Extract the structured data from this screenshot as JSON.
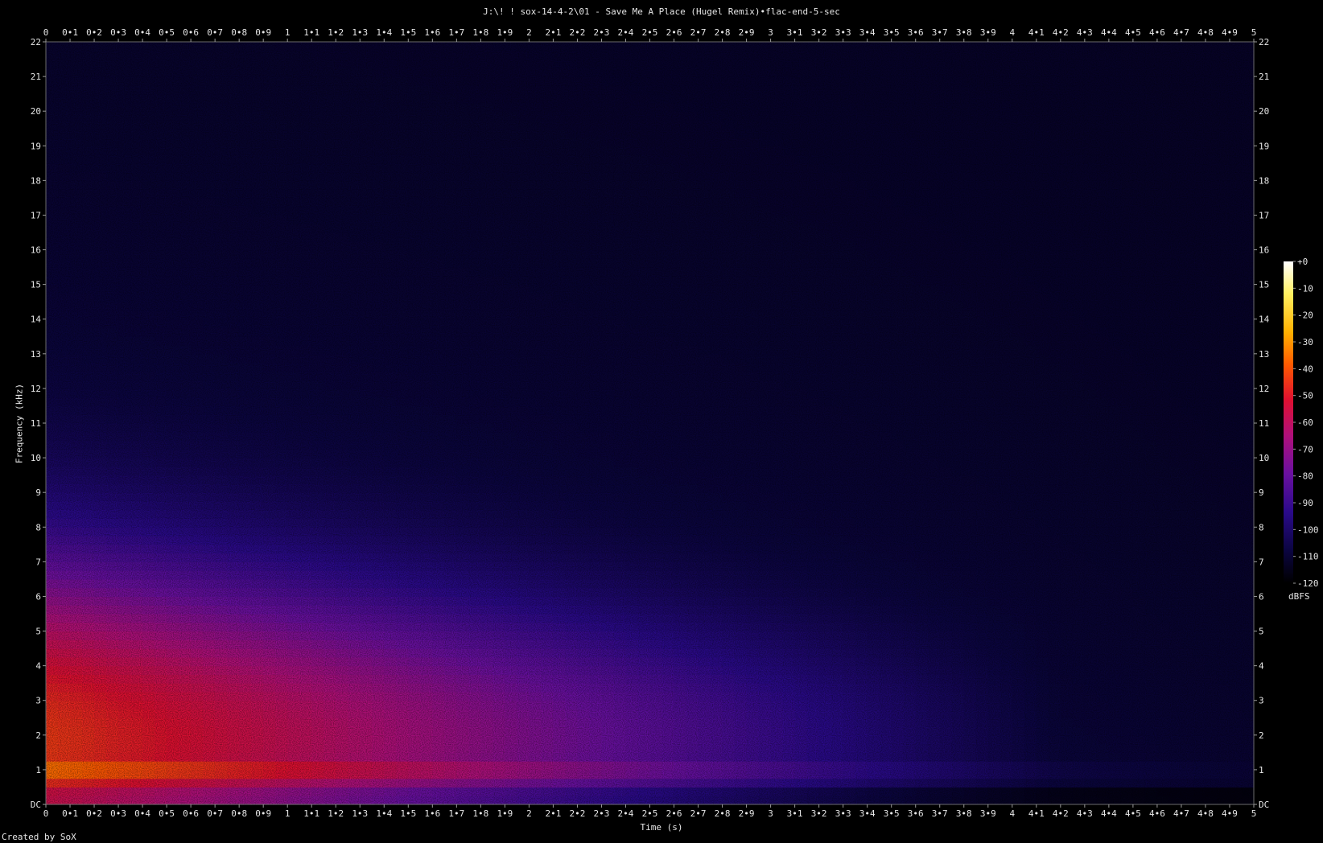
{
  "title": "J:\\! ! sox-14-4-2\\01 - Save Me A Place (Hugel Remix)•flac-end-5-sec",
  "footer": "Created by SoX",
  "colorbar": {
    "unit": "dBFS",
    "ticks": [
      "+0",
      "-10",
      "-20",
      "-30",
      "-40",
      "-50",
      "-60",
      "-70",
      "-80",
      "-90",
      "-100",
      "-110",
      "-120"
    ]
  },
  "chart_data": {
    "type": "heatmap",
    "title": "J:\\! ! sox-14-4-2\\01 - Save Me A Place (Hugel Remix)•flac-end-5-sec",
    "xlabel": "Time (s)",
    "ylabel": "Frequency (kHz)",
    "xlim": [
      0,
      5
    ],
    "ylim": [
      0,
      22
    ],
    "x_tick_labels": [
      "0",
      "0•1",
      "0•2",
      "0•3",
      "0•4",
      "0•5",
      "0•6",
      "0•7",
      "0•8",
      "0•9",
      "1",
      "1•1",
      "1•2",
      "1•3",
      "1•4",
      "1•5",
      "1•6",
      "1•7",
      "1•8",
      "1•9",
      "2",
      "2•1",
      "2•2",
      "2•3",
      "2•4",
      "2•5",
      "2•6",
      "2•7",
      "2•8",
      "2•9",
      "3",
      "3•1",
      "3•2",
      "3•3",
      "3•4",
      "3•5",
      "3•6",
      "3•7",
      "3•8",
      "3•9",
      "4",
      "4•1",
      "4•2",
      "4•3",
      "4•4",
      "4•5",
      "4•6",
      "4•7",
      "4•8",
      "4•9",
      "5"
    ],
    "y_tick_labels": [
      "DC",
      "1",
      "2",
      "3",
      "4",
      "5",
      "6",
      "7",
      "8",
      "9",
      "10",
      "11",
      "12",
      "13",
      "14",
      "15",
      "16",
      "17",
      "18",
      "19",
      "20",
      "21",
      "22"
    ],
    "z_unit": "dBFS",
    "z_range": [
      -120,
      0
    ],
    "colors": {
      "background": "#000000",
      "colormap": [
        "#000000",
        "#0b0540",
        "#2a0a8a",
        "#6a10a0",
        "#b0107a",
        "#e01030",
        "#ff5a00",
        "#ffb000",
        "#fff060",
        "#ffffff"
      ]
    }
  }
}
